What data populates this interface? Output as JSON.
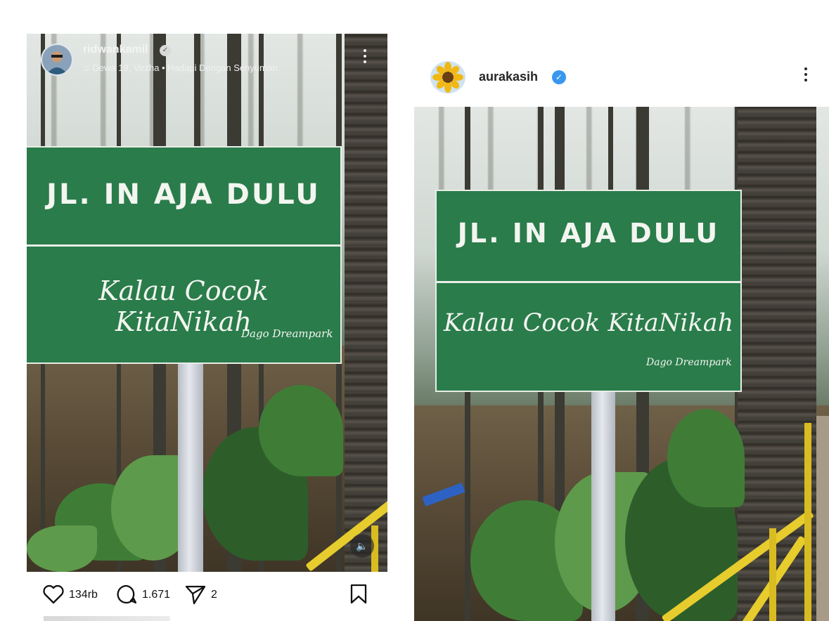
{
  "left_post": {
    "username": "ridwankamil",
    "verified": true,
    "music": {
      "icon": "music-note-icon",
      "text": "Dewa 19, Virzha • Hadapi Dengan Senyuman"
    },
    "sound_icon": "speaker-icon",
    "actions": {
      "likes": "134rb",
      "comments": "1.671",
      "shares": "2"
    }
  },
  "right_post": {
    "username": "aurakasih",
    "verified": true
  },
  "sign": {
    "line1": "JL. IN AJA DULU",
    "line2": "Kalau Cocok KitaNikah",
    "credit": "Dago Dreampark"
  },
  "colors": {
    "sign_green": "#2a7c4b",
    "verified_blue": "#3897f0",
    "rail_yellow": "#e7cc2d"
  }
}
